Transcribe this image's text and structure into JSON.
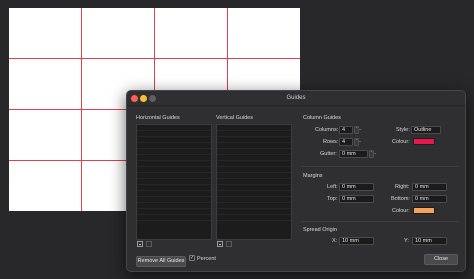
{
  "dialog": {
    "title": "Guides",
    "horizontal_label": "Horizontal Guides",
    "vertical_label": "Vertical Guides",
    "column_guides": {
      "heading": "Column Guides",
      "columns_label": "Columns:",
      "columns_value": "4",
      "rows_label": "Rows:",
      "rows_value": "4",
      "gutter_label": "Gutter:",
      "gutter_value": "0 mm",
      "style_label": "Style:",
      "style_value": "Outline",
      "colour_label": "Colour:",
      "colour": "#e8184f"
    },
    "margins": {
      "heading": "Margins",
      "left_label": "Left:",
      "left_value": "0 mm",
      "right_label": "Right:",
      "right_value": "0 mm",
      "top_label": "Top:",
      "top_value": "0 mm",
      "bottom_label": "Bottom:",
      "bottom_value": "0 mm",
      "colour_label": "Colour:",
      "colour": "#f5a25a"
    },
    "spread_origin": {
      "heading": "Spread Origin",
      "x_label": "X:",
      "x_value": "10 mm",
      "y_label": "Y:",
      "y_value": "10 mm"
    },
    "remove_all_label": "Remove All Guides",
    "percent_label": "Percent",
    "percent_checked": "✓",
    "close_label": "Close"
  },
  "colors": {
    "guide_line": "#e0404f",
    "page": "#ffffff",
    "background": "#28282a"
  }
}
